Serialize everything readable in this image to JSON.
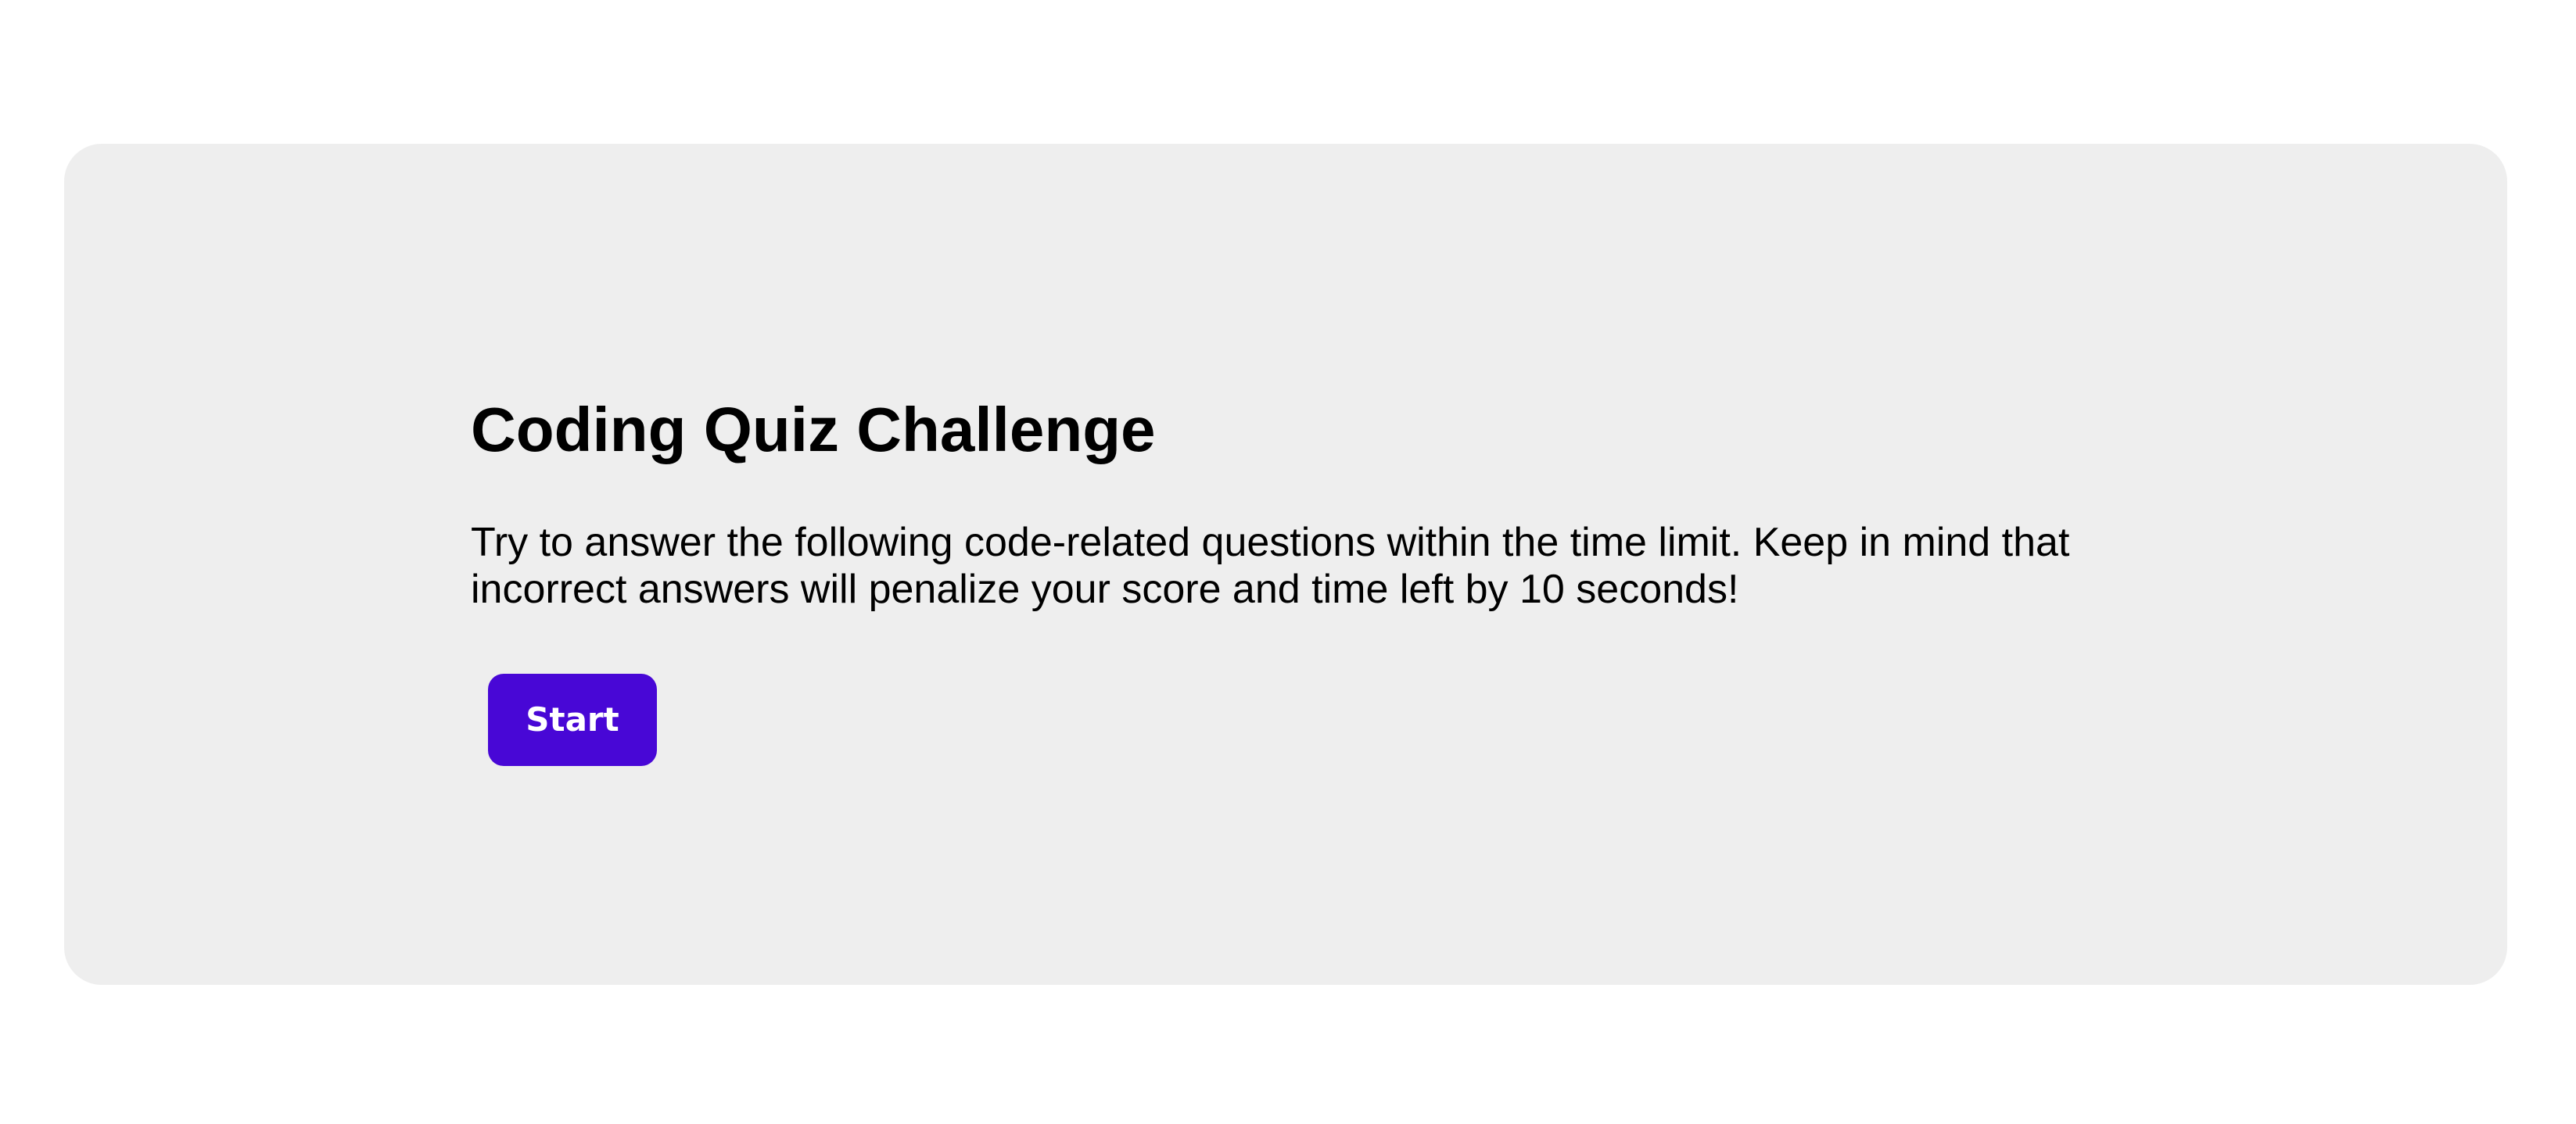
{
  "quiz": {
    "title": "Coding Quiz Challenge",
    "description": "Try to answer the following code-related questions within the time limit. Keep in mind that incorrect answers will penalize your score and time left by 10 seconds!",
    "start_label": "Start"
  },
  "colors": {
    "card_background": "#eeeeee",
    "accent": "#4807d6",
    "page_background": "#ffffff"
  }
}
